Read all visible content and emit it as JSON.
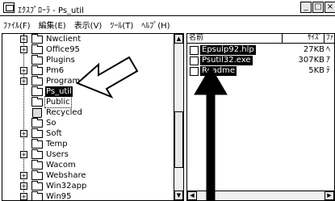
{
  "window": {
    "title": "ｴｸｽﾌﾟﾛｰﾗ - Ps_util",
    "minimize_glyph": "_",
    "maximize_glyph": "□",
    "close_glyph": "×"
  },
  "menu": [
    {
      "label": "ﾌｧｲﾙ(F)"
    },
    {
      "label": "編集(E)"
    },
    {
      "label": "表示(V)"
    },
    {
      "label": "ﾂｰﾙ(T)"
    },
    {
      "label": "ﾍﾙﾌﾟ(H)"
    }
  ],
  "tree": {
    "items": [
      {
        "label": "Nwclient",
        "expander": "+",
        "icon": "folder-icon"
      },
      {
        "label": "Office95",
        "expander": "+",
        "icon": "folder-icon"
      },
      {
        "label": "Plugins",
        "expander": "",
        "icon": "folder-icon"
      },
      {
        "label": "Pm6",
        "expander": "+",
        "icon": "folder-icon"
      },
      {
        "label": "Program Files",
        "expander": "+",
        "icon": "folder-icon"
      },
      {
        "label": "Ps_util",
        "expander": "",
        "icon": "folder-icon",
        "selected": true
      },
      {
        "label": "Public",
        "expander": "",
        "icon": "folder-icon"
      },
      {
        "label": "Recycled",
        "expander": "",
        "icon": "recycle-bin-icon"
      },
      {
        "label": "So",
        "expander": "",
        "icon": "folder-icon"
      },
      {
        "label": "Soft",
        "expander": "+",
        "icon": "folder-icon"
      },
      {
        "label": "Temp",
        "expander": "",
        "icon": "folder-icon"
      },
      {
        "label": "Users",
        "expander": "+",
        "icon": "folder-icon"
      },
      {
        "label": "Wacom",
        "expander": "",
        "icon": "folder-icon"
      },
      {
        "label": "Webshare",
        "expander": "+",
        "icon": "folder-icon"
      },
      {
        "label": "Win32app",
        "expander": "+",
        "icon": "folder-icon"
      },
      {
        "label": "Win95",
        "expander": "+",
        "icon": "folder-icon"
      }
    ]
  },
  "list": {
    "columns": {
      "name": "名前",
      "size": "ｻｲｽﾞ",
      "type": "ﾌｧ"
    },
    "files": [
      {
        "name": "Epsulp92.hlp",
        "size": "27KB",
        "type": "ﾍ",
        "icon": "help-file-icon"
      },
      {
        "name": "Psutil32.exe",
        "size": "307KB",
        "type": "ｱ",
        "icon": "exe-file-icon"
      },
      {
        "name": "Readme",
        "size": "5KB",
        "type": "ﾃ",
        "icon": "text-file-icon"
      }
    ]
  },
  "scroll": {
    "up": "▲",
    "down": "▼",
    "left": "◀",
    "right": "▶"
  },
  "annotations": {
    "arrow_left": "outline-arrow-icon",
    "arrow_up": "black-arrow-icon"
  }
}
